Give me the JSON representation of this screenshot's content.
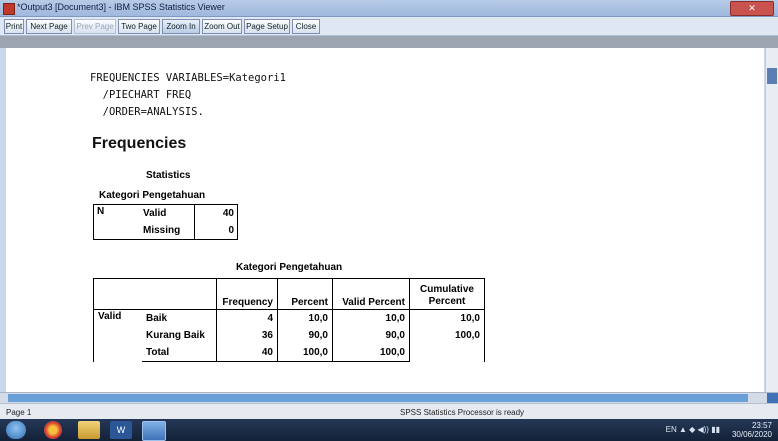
{
  "window": {
    "title": "*Output3 [Document3] - IBM SPSS Statistics Viewer"
  },
  "toolbar": {
    "buttons": [
      "Print",
      "Next Page",
      "Prev Page",
      "Two Page",
      "Zoom In",
      "Zoom Out",
      "Page Setup",
      "Close"
    ]
  },
  "syntax": [
    "FREQUENCIES VARIABLES=Kategori1",
    "  /PIECHART FREQ",
    "  /ORDER=ANALYSIS."
  ],
  "heading": "Frequencies",
  "statistics": {
    "title": "Statistics",
    "caption": "Kategori Pengetahuan",
    "row_label": "N",
    "valid_label": "Valid",
    "valid_value": "40",
    "missing_label": "Missing",
    "missing_value": "0"
  },
  "kategori": {
    "title": "Kategori Pengetahuan",
    "headers": [
      "Frequency",
      "Percent",
      "Valid Percent",
      "Cumulative Percent"
    ],
    "group_label": "Valid",
    "rows": [
      {
        "label": "Baik",
        "frequency": "4",
        "percent": "10,0",
        "valid_percent": "10,0",
        "cumulative": "10,0"
      },
      {
        "label": "Kurang Baik",
        "frequency": "36",
        "percent": "90,0",
        "valid_percent": "90,0",
        "cumulative": "100,0"
      },
      {
        "label": "Total",
        "frequency": "40",
        "percent": "100,0",
        "valid_percent": "100,0",
        "cumulative": ""
      }
    ]
  },
  "status": {
    "page": "Page 1",
    "processor": "SPSS Statistics Processor is ready"
  },
  "taskbar": {
    "time": "23:57",
    "date": "30/06/2020",
    "lang": "EN"
  }
}
